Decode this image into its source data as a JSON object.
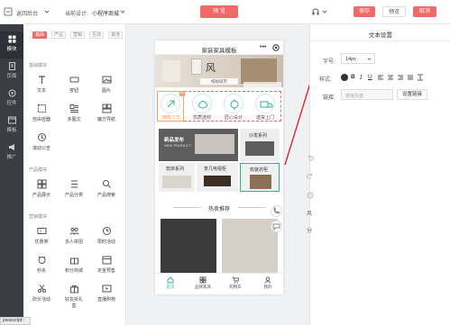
{
  "topbar": {
    "back_label": "返回后台",
    "current_label": "当前设计:",
    "store_name": "小程序商城",
    "preview_label": "预 览",
    "save_label": "保存",
    "publish_label": "预览",
    "cancel_label": "取消"
  },
  "leftnav": {
    "items": [
      {
        "label": "模块",
        "icon": "grid-icon"
      },
      {
        "label": "页面",
        "icon": "page-icon"
      },
      {
        "label": "控件",
        "icon": "control-icon"
      },
      {
        "label": "模板",
        "icon": "template-icon"
      },
      {
        "label": "推广",
        "icon": "promo-icon"
      }
    ]
  },
  "panel": {
    "tabs": [
      "基础",
      "产品",
      "营销",
      "互动",
      "其他"
    ],
    "sections": [
      {
        "title": "基础模块",
        "items": [
          "文本",
          "按钮",
          "图片",
          "自由容器",
          "多图文",
          "魔方导航",
          "滚动公告"
        ]
      },
      {
        "title": "产品模块",
        "items": [
          "产品展示",
          "产品分类",
          "产品搜索"
        ]
      },
      {
        "title": "营销模块",
        "items": [
          "优惠券",
          "多人拼团",
          "限时活动",
          "秒杀",
          "积分商城",
          "定金预售",
          "砍价活动",
          "好友拆礼盒",
          "直播购物"
        ]
      }
    ]
  },
  "phone": {
    "title": "家装家具模板",
    "banner_text": "风",
    "banner_caption": "揭秘城市",
    "icons": [
      "精致工艺",
      "优质选材",
      "匠心设计",
      "送货上门"
    ],
    "promo_tiles": [
      {
        "title": "新品发布",
        "sub": "NEW PRODUCT"
      },
      {
        "title": "沙发系列",
        "sub": ""
      },
      {
        "title": "软床系列",
        "sub": ""
      },
      {
        "title": "茶几电视柜",
        "sub": ""
      },
      {
        "title": "软装衣柜",
        "sub": ""
      }
    ],
    "section_title": "热卖推荐",
    "bottom_nav": [
      "首页",
      "品牌家具",
      "购物车",
      "我的"
    ]
  },
  "props": {
    "title": "文本设置",
    "size_label": "字号:",
    "size_value": "14px",
    "style_label": "样式:",
    "link_label": "链接:",
    "link_placeholder": "链接页面",
    "link_button": "设置链接",
    "side_tools": [
      "风",
      "分"
    ]
  },
  "status": {
    "text": "javascript:;"
  },
  "colors": {
    "accent": "#f16a6a",
    "teal": "#2bb39a",
    "sidebar": "#3a3d44"
  }
}
